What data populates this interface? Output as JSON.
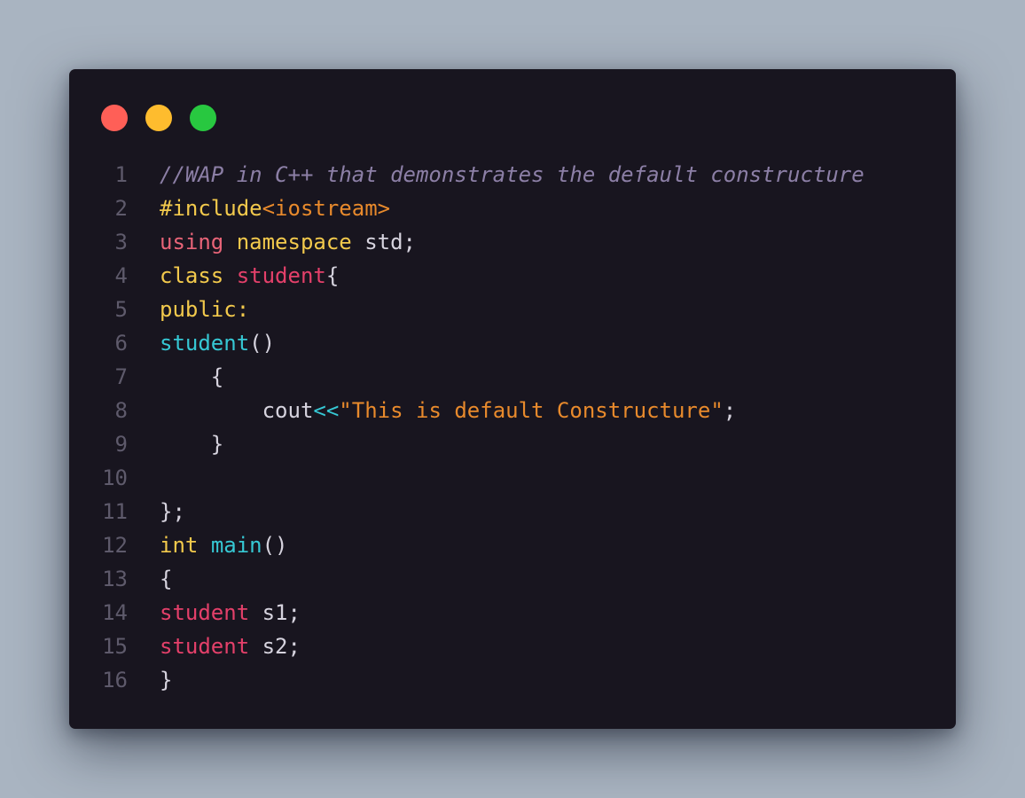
{
  "window": {
    "controls": [
      "close",
      "minimize",
      "maximize"
    ],
    "colors": {
      "close": "#ff5f57",
      "minimize": "#febc2e",
      "maximize": "#28c840",
      "background": "#18151f"
    }
  },
  "code": {
    "lines": [
      {
        "number": "1",
        "tokens": [
          {
            "t": "//WAP in C++ that demonstrates the default constructure",
            "c": "comment"
          }
        ]
      },
      {
        "number": "2",
        "tokens": [
          {
            "t": "#include",
            "c": "pre"
          },
          {
            "t": "<iostream>",
            "c": "header"
          }
        ]
      },
      {
        "number": "3",
        "tokens": [
          {
            "t": "using",
            "c": "kw-red"
          },
          {
            "t": " ",
            "c": "plain"
          },
          {
            "t": "namespace",
            "c": "kw"
          },
          {
            "t": " std;",
            "c": "plain"
          }
        ]
      },
      {
        "number": "4",
        "tokens": [
          {
            "t": "class",
            "c": "kw"
          },
          {
            "t": " ",
            "c": "plain"
          },
          {
            "t": "student",
            "c": "type"
          },
          {
            "t": "{",
            "c": "plain"
          }
        ]
      },
      {
        "number": "5",
        "tokens": [
          {
            "t": "public:",
            "c": "kw"
          }
        ]
      },
      {
        "number": "6",
        "tokens": [
          {
            "t": "student",
            "c": "fn"
          },
          {
            "t": "()",
            "c": "plain"
          }
        ]
      },
      {
        "number": "7",
        "tokens": [
          {
            "t": "    {",
            "c": "plain"
          }
        ]
      },
      {
        "number": "8",
        "tokens": [
          {
            "t": "        cout",
            "c": "plain"
          },
          {
            "t": "<<",
            "c": "op"
          },
          {
            "t": "\"This is default Constructure\"",
            "c": "str"
          },
          {
            "t": ";",
            "c": "plain"
          }
        ]
      },
      {
        "number": "9",
        "tokens": [
          {
            "t": "    }",
            "c": "plain"
          }
        ]
      },
      {
        "number": "10",
        "tokens": []
      },
      {
        "number": "11",
        "tokens": [
          {
            "t": "};",
            "c": "plain"
          }
        ]
      },
      {
        "number": "12",
        "tokens": [
          {
            "t": "int",
            "c": "kw"
          },
          {
            "t": " ",
            "c": "plain"
          },
          {
            "t": "main",
            "c": "fn"
          },
          {
            "t": "()",
            "c": "plain"
          }
        ]
      },
      {
        "number": "13",
        "tokens": [
          {
            "t": "{",
            "c": "plain"
          }
        ]
      },
      {
        "number": "14",
        "tokens": [
          {
            "t": "student",
            "c": "type"
          },
          {
            "t": " s1;",
            "c": "plain"
          }
        ]
      },
      {
        "number": "15",
        "tokens": [
          {
            "t": "student",
            "c": "type"
          },
          {
            "t": " s2;",
            "c": "plain"
          }
        ]
      },
      {
        "number": "16",
        "tokens": [
          {
            "t": "}",
            "c": "plain"
          }
        ]
      }
    ]
  }
}
